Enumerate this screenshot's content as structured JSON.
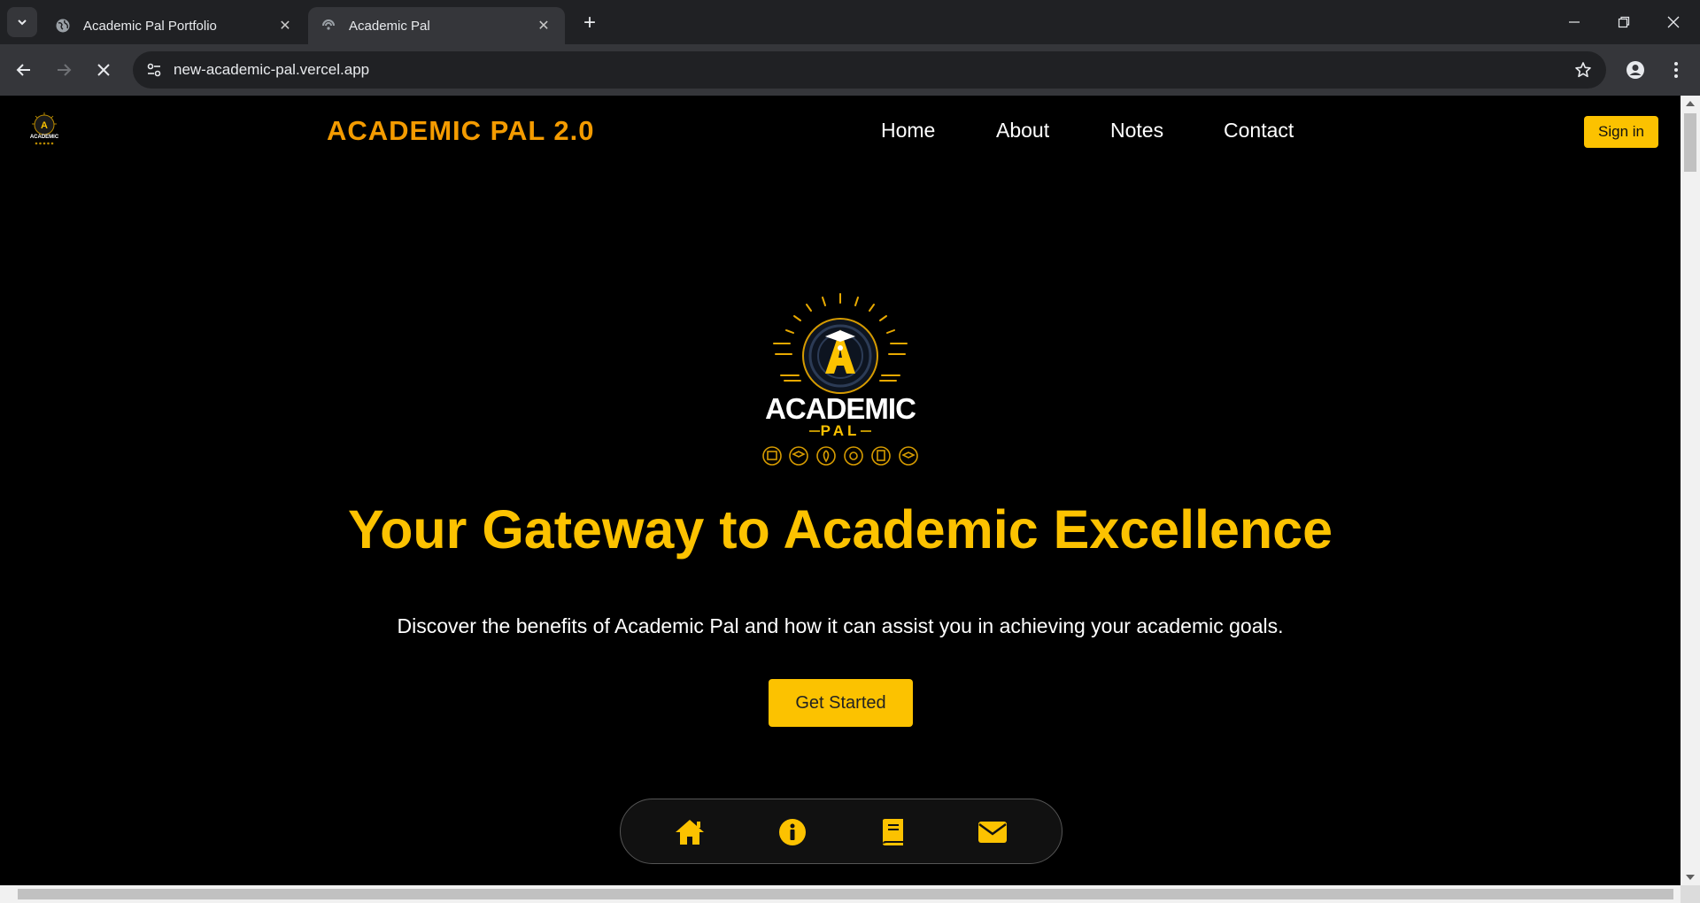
{
  "browser": {
    "tabs": [
      {
        "title": "Academic Pal Portfolio",
        "active": false,
        "favicon": "globe-icon"
      },
      {
        "title": "Academic Pal",
        "active": true,
        "favicon": "site-favicon"
      }
    ],
    "url": "new-academic-pal.vercel.app",
    "icons": [
      "tab-search-icon",
      "close-icon",
      "new-tab-icon",
      "minimize-icon",
      "restore-icon",
      "window-close-icon",
      "back-icon",
      "forward-icon",
      "stop-loading-icon",
      "site-info-icon",
      "bookmark-star-icon",
      "profile-icon",
      "menu-dots-icon"
    ]
  },
  "site": {
    "brand": "ACADEMIC PAL 2.0",
    "nav": [
      "Home",
      "About",
      "Notes",
      "Contact"
    ],
    "signin_label": "Sign in",
    "accent_color": "#fcc200",
    "brand_color": "#f49b00",
    "logo": {
      "word1": "ACADEMIC",
      "word2": "PAL",
      "letter": "A"
    },
    "hero": {
      "title": "Your Gateway to Academic Excellence",
      "subtitle": "Discover the benefits of Academic Pal and how it can assist you in achieving your academic goals.",
      "cta_label": "Get Started"
    },
    "floatnav": [
      "home-icon",
      "info-icon",
      "book-icon",
      "mail-icon"
    ]
  }
}
